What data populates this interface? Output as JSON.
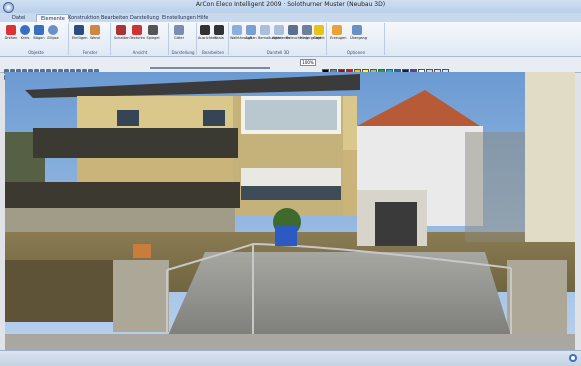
{
  "window": {
    "title": "ArCon Eleco Intelligent 2009 · Solothurner Muster (Neubau 3D)",
    "colors": {
      "titlebar": "#c8d9ee",
      "ribbon": "#eef3f9",
      "accent": "#e07a1c"
    }
  },
  "ribbon": {
    "tabs": [
      {
        "label": "Datei"
      },
      {
        "label": "Elemente"
      },
      {
        "label": "Konstruktion"
      },
      {
        "label": "Bearbeiten"
      },
      {
        "label": "Darstellung"
      },
      {
        "label": "Einstellungen"
      },
      {
        "label": "Hilfe"
      }
    ],
    "active_tab_index": 1,
    "groups": [
      {
        "label": "Objekte",
        "buttons": [
          "Drehen",
          "Kreis",
          "Bögen",
          "Ellipse",
          "Rechteck"
        ]
      },
      {
        "label": "Fenster",
        "buttons": [
          "Einfügen",
          "Wand",
          "Teilen"
        ]
      },
      {
        "label": "Ansicht",
        "buttons": [
          "Schatten",
          "Texturen",
          "Spiegel"
        ]
      },
      {
        "label": "Darstellung",
        "buttons": [
          "Gitter",
          "Raster"
        ]
      },
      {
        "label": "Bearbeiten",
        "buttons": [
          "Ausrichten",
          "Skala"
        ]
      },
      {
        "label": "Darstell 3D",
        "buttons": [
          "Walkthrough",
          "Außen",
          "Bemaßungen",
          "Aktivieren",
          "Beleuchtung",
          "Hintergrund",
          "Objekt"
        ]
      },
      {
        "label": "Optionen",
        "buttons": [
          "Erzeugen",
          "Übergang"
        ]
      }
    ]
  },
  "toolbar": {
    "zoom": "100%",
    "palette": [
      "#000000",
      "#7f7f7f",
      "#c00000",
      "#ff0000",
      "#ffc000",
      "#ffff00",
      "#92d050",
      "#00b050",
      "#00b0f0",
      "#0070c0",
      "#002060",
      "#7030a0",
      "#ffffff",
      "#d9d9d9",
      "#f2dcdb",
      "#dbe5f1"
    ]
  },
  "status": {
    "icon": "help-icon"
  }
}
